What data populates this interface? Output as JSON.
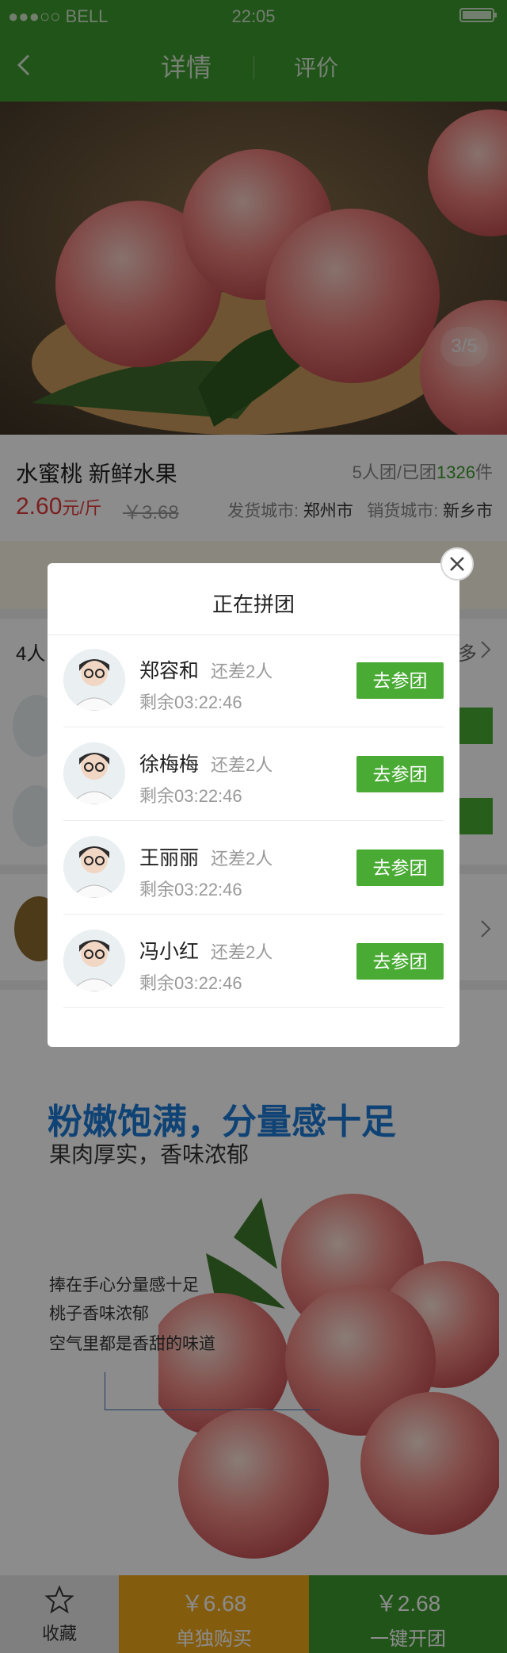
{
  "status_bar": {
    "carrier": "●●●○○ BELL",
    "time": "22:05"
  },
  "nav": {
    "tab_detail": "详情",
    "tab_review": "评价"
  },
  "gallery": {
    "pager": "3/5"
  },
  "product": {
    "name": "水蜜桃 新鲜水果",
    "group_info_prefix": "5人团/已团",
    "group_count": "1326",
    "group_info_suffix": "件",
    "price": "2.60",
    "price_unit": "元/斤",
    "original_price": "￥3.68",
    "ship_city_label": "发货城市:",
    "ship_city": "郑州市",
    "sale_city_label": "销货城市:",
    "sale_city": "新乡市"
  },
  "behind": {
    "group_label": "4人",
    "more": "多"
  },
  "modal": {
    "title": "正在拼团",
    "groups": [
      {
        "name": "郑容和",
        "need": "还差2人",
        "remaining": "剩余03:22:46",
        "button": "去参团"
      },
      {
        "name": "徐梅梅",
        "need": "还差2人",
        "remaining": "剩余03:22:46",
        "button": "去参团"
      },
      {
        "name": "王丽丽",
        "need": "还差2人",
        "remaining": "剩余03:22:46",
        "button": "去参团"
      },
      {
        "name": "冯小红",
        "need": "还差2人",
        "remaining": "剩余03:22:46",
        "button": "去参团"
      }
    ]
  },
  "promo": {
    "headline": "粉嫩饱满，分量感十足",
    "subhead": "果肉厚实，香味浓郁",
    "lines": [
      "捧在手心分量感十足",
      "桃子香味浓郁",
      "空气里都是香甜的味道"
    ]
  },
  "bottom_bar": {
    "favorite": "收藏",
    "solo_price": "￥6.68",
    "solo_label": "单独购买",
    "group_price": "￥2.68",
    "group_label": "一键开团"
  },
  "colors": {
    "brand_green": "#3d9a2e",
    "button_green": "#4aab34",
    "price_red": "#e23a3a",
    "buy_orange": "#f0a81a",
    "promo_blue": "#1e7bd6"
  }
}
